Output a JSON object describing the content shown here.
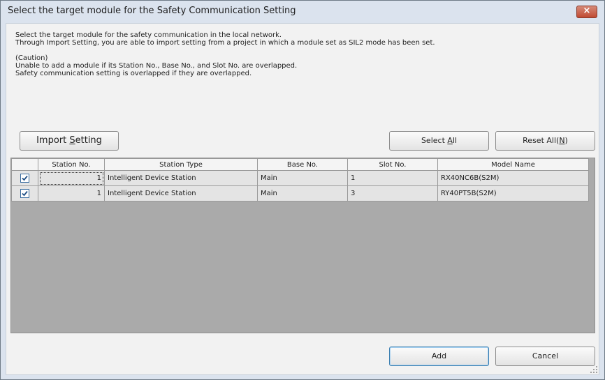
{
  "window": {
    "title": "Select the target module for the Safety Communication Setting",
    "close_label": "×"
  },
  "description": {
    "line1": "Select the target module for the safety communication in the local network.",
    "line2": "Through Import Setting, you are able to import setting from a project in which a module set as SIL2 mode has been set.",
    "caution_title": "(Caution)",
    "caution_line1": "Unable to add a module if its Station No., Base No., and Slot No. are overlapped.",
    "caution_line2": "Safety communication setting is overlapped if they are overlapped."
  },
  "toolbar": {
    "import_prefix": "Import ",
    "import_mnemonic": "S",
    "import_suffix": "etting",
    "select_all_prefix": "Select ",
    "select_all_mnemonic": "A",
    "select_all_suffix": "ll",
    "reset_all_prefix": "Reset All(",
    "reset_all_mnemonic": "N",
    "reset_all_suffix": ")"
  },
  "table": {
    "columns": [
      "",
      "Station No.",
      "Station Type",
      "Base No.",
      "Slot No.",
      "Model Name"
    ],
    "rows": [
      {
        "checked": true,
        "station_no": "1",
        "station_type": "Intelligent Device Station",
        "base_no": "Main",
        "slot_no": "1",
        "model_name": "RX40NC6B(S2M)"
      },
      {
        "checked": true,
        "station_no": "1",
        "station_type": "Intelligent Device Station",
        "base_no": "Main",
        "slot_no": "3",
        "model_name": "RY40PT5B(S2M)"
      }
    ]
  },
  "footer": {
    "add_label": "Add",
    "cancel_label": "Cancel"
  },
  "colors": {
    "accent": "#3c7fb1",
    "close_red": "#c04a32"
  },
  "icons": [
    "close-icon",
    "checkbox-checked-icon",
    "resize-grip-icon"
  ]
}
